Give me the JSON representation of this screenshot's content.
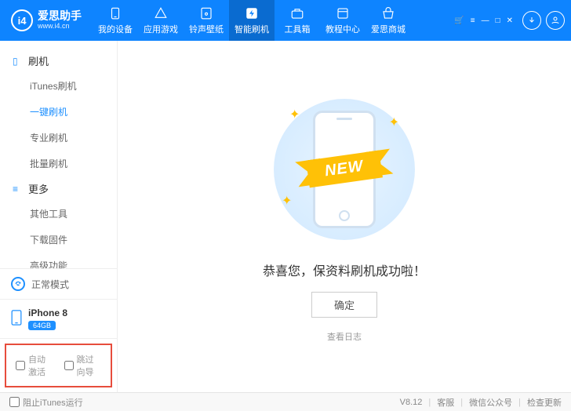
{
  "header": {
    "logo_text": "i4",
    "brand": "爱思助手",
    "url": "www.i4.cn",
    "nav": [
      {
        "label": "我的设备",
        "icon": "phone"
      },
      {
        "label": "应用游戏",
        "icon": "apps"
      },
      {
        "label": "铃声壁纸",
        "icon": "music"
      },
      {
        "label": "智能刷机",
        "icon": "flash",
        "active": true
      },
      {
        "label": "工具箱",
        "icon": "toolbox"
      },
      {
        "label": "教程中心",
        "icon": "book"
      },
      {
        "label": "爱思商城",
        "icon": "shop"
      }
    ]
  },
  "sidebar": {
    "groups": [
      {
        "title": "刷机",
        "icon": "phone",
        "items": [
          {
            "label": "iTunes刷机"
          },
          {
            "label": "一键刷机",
            "active": true
          },
          {
            "label": "专业刷机"
          },
          {
            "label": "批量刷机"
          }
        ]
      },
      {
        "title": "更多",
        "icon": "menu",
        "items": [
          {
            "label": "其他工具"
          },
          {
            "label": "下载固件"
          },
          {
            "label": "高级功能"
          }
        ]
      }
    ],
    "mode_label": "正常模式",
    "device_name": "iPhone 8",
    "device_storage": "64GB",
    "check1": "自动激活",
    "check2": "跳过向导"
  },
  "main": {
    "ribbon": "NEW",
    "success": "恭喜您，保资料刷机成功啦！",
    "ok": "确定",
    "view_log": "查看日志"
  },
  "footer": {
    "block_itunes": "阻止iTunes运行",
    "version": "V8.12",
    "links": [
      "客服",
      "微信公众号",
      "检查更新"
    ]
  }
}
